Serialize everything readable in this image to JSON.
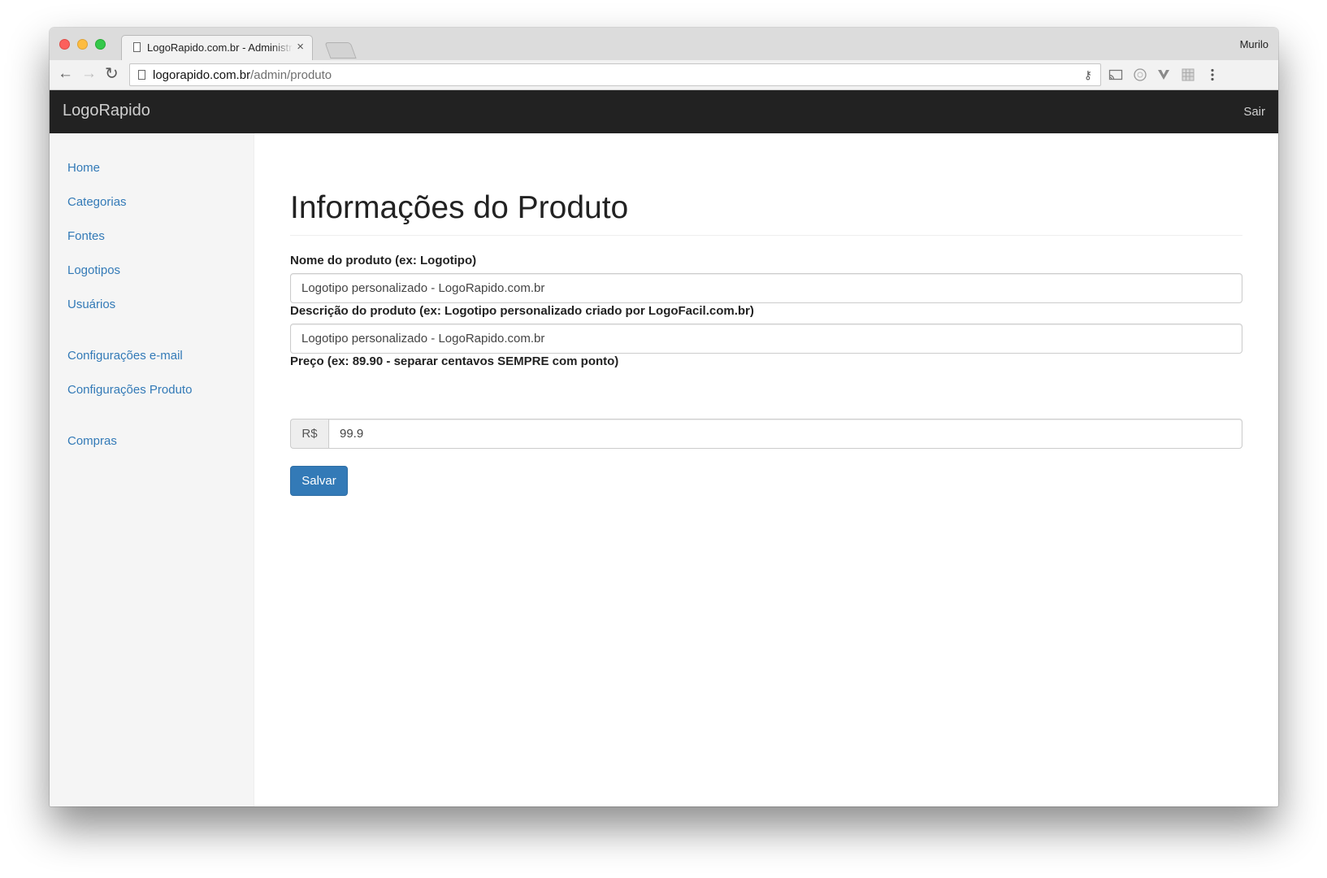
{
  "browser": {
    "tab_title": "LogoRapido.com.br - Administração",
    "profile_name": "Murilo",
    "url_host": "logorapido.com.br",
    "url_path": "/admin/produto"
  },
  "navbar": {
    "brand": "LogoRapido",
    "logout": "Sair"
  },
  "sidebar": {
    "items": [
      {
        "label": "Home"
      },
      {
        "label": "Categorias"
      },
      {
        "label": "Fontes"
      },
      {
        "label": "Logotipos"
      },
      {
        "label": "Usuários"
      },
      {
        "label": "Configurações e-mail"
      },
      {
        "label": "Configurações Produto"
      },
      {
        "label": "Compras"
      }
    ]
  },
  "form": {
    "title": "Informações do Produto",
    "name_label": "Nome do produto (ex: Logotipo)",
    "name_value": "Logotipo personalizado - LogoRapido.com.br",
    "description_label": "Descrição do produto (ex: Logotipo personalizado criado por LogoFacil.com.br)",
    "description_value": "Logotipo personalizado - LogoRapido.com.br",
    "price_label": "Preço (ex: 89.90 - separar centavos SEMPRE com ponto)",
    "currency": "R$",
    "price_value": "99.9",
    "save_label": "Salvar"
  },
  "icons": {
    "back": "arrow-left-icon",
    "forward": "arrow-right-icon",
    "reload": "reload-icon",
    "key": "key-icon",
    "cast": "cast-icon",
    "extension_circle": "circle-extension-icon",
    "extension_v": "v-extension-icon",
    "extension_grid": "grid-extension-icon",
    "menu": "kebab-menu-icon"
  },
  "colors": {
    "navbar_bg": "#222222",
    "link": "#337ab7",
    "primary_button": "#337ab7",
    "sidebar_bg": "#f5f5f5"
  }
}
